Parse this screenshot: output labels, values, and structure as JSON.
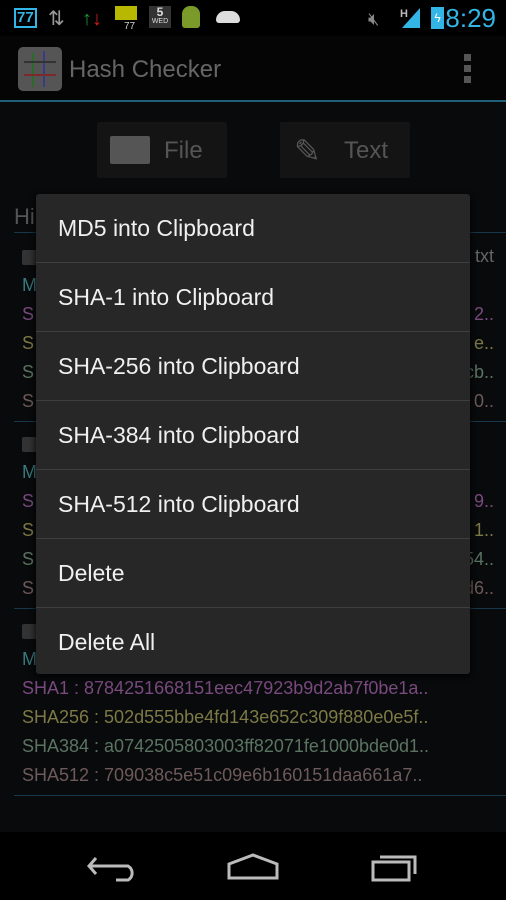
{
  "status_bar": {
    "notification_count": "77",
    "calendar_day": "5",
    "calendar_weekday": "WED",
    "battery_small": "77",
    "network": "H",
    "time": "8:29",
    "icons": [
      "notification-count-icon",
      "data-transfer-icon",
      "data-transfer-color-icon",
      "battery-meter-icon",
      "calendar-icon",
      "android-icon",
      "android-head-icon",
      "mute-icon",
      "signal-icon",
      "battery-charging-icon"
    ]
  },
  "app_bar": {
    "title": "Hash Checker",
    "icon": "hash-icon",
    "menu_icon": "overflow-menu-icon"
  },
  "buttons": {
    "file": "File",
    "text": "Text"
  },
  "history": {
    "heading": "Hi",
    "groups": [
      {
        "lines": [
          {
            "type": "file",
            "prefix": "",
            "suffix": "txt"
          },
          {
            "type": "md5",
            "prefix": "M",
            "suffix": ""
          },
          {
            "type": "sha1",
            "prefix": "S",
            "suffix": "2.."
          },
          {
            "type": "sha256",
            "prefix": "S",
            "suffix": "e.."
          },
          {
            "type": "sha384",
            "prefix": "S",
            "suffix": "cb.."
          },
          {
            "type": "sha512",
            "prefix": "S",
            "suffix": "0.."
          }
        ]
      },
      {
        "lines": [
          {
            "type": "file",
            "prefix": "",
            "suffix": ""
          },
          {
            "type": "md5",
            "prefix": "M",
            "suffix": ""
          },
          {
            "type": "sha1",
            "prefix": "S",
            "suffix": "9.."
          },
          {
            "type": "sha256",
            "prefix": "S",
            "suffix": "1.."
          },
          {
            "type": "sha384",
            "prefix": "S",
            "suffix": "54.."
          },
          {
            "type": "sha512",
            "prefix": "S",
            "suffix": "d6.."
          }
        ]
      },
      {
        "lines": [
          {
            "type": "file",
            "prefix": "",
            "suffix": ""
          },
          {
            "type": "md5",
            "prefix": "M",
            "suffix": ""
          },
          {
            "type": "sha1",
            "prefix": "SHA1 : 8784251668151eec47923b9d2ab7f0be1a..",
            "suffix": ""
          },
          {
            "type": "sha256",
            "prefix": "SHA256 : 502d555bbe4fd143e652c309f880e0e5f..",
            "suffix": ""
          },
          {
            "type": "sha384",
            "prefix": "SHA384 : a0742505803003ff82071fe1000bde0d1..",
            "suffix": ""
          },
          {
            "type": "sha512",
            "prefix": "SHA512 : 709038c5e51c09e6b160151daa661a7..",
            "suffix": ""
          }
        ]
      }
    ]
  },
  "colors": {
    "md5": "#3b7a7e",
    "sha1": "#7a4a7e",
    "sha256": "#7d7a45",
    "sha384": "#5b7462",
    "sha512": "#6e5a5a",
    "file": "#666666",
    "accent": "#33b5e5"
  },
  "context_menu": {
    "items": [
      "MD5 into Clipboard",
      "SHA-1 into Clipboard",
      "SHA-256 into Clipboard",
      "SHA-384 into Clipboard",
      "SHA-512 into Clipboard",
      "Delete",
      "Delete All"
    ]
  },
  "nav_bar": {
    "icons": [
      "back-icon",
      "home-icon",
      "recent-apps-icon"
    ]
  }
}
